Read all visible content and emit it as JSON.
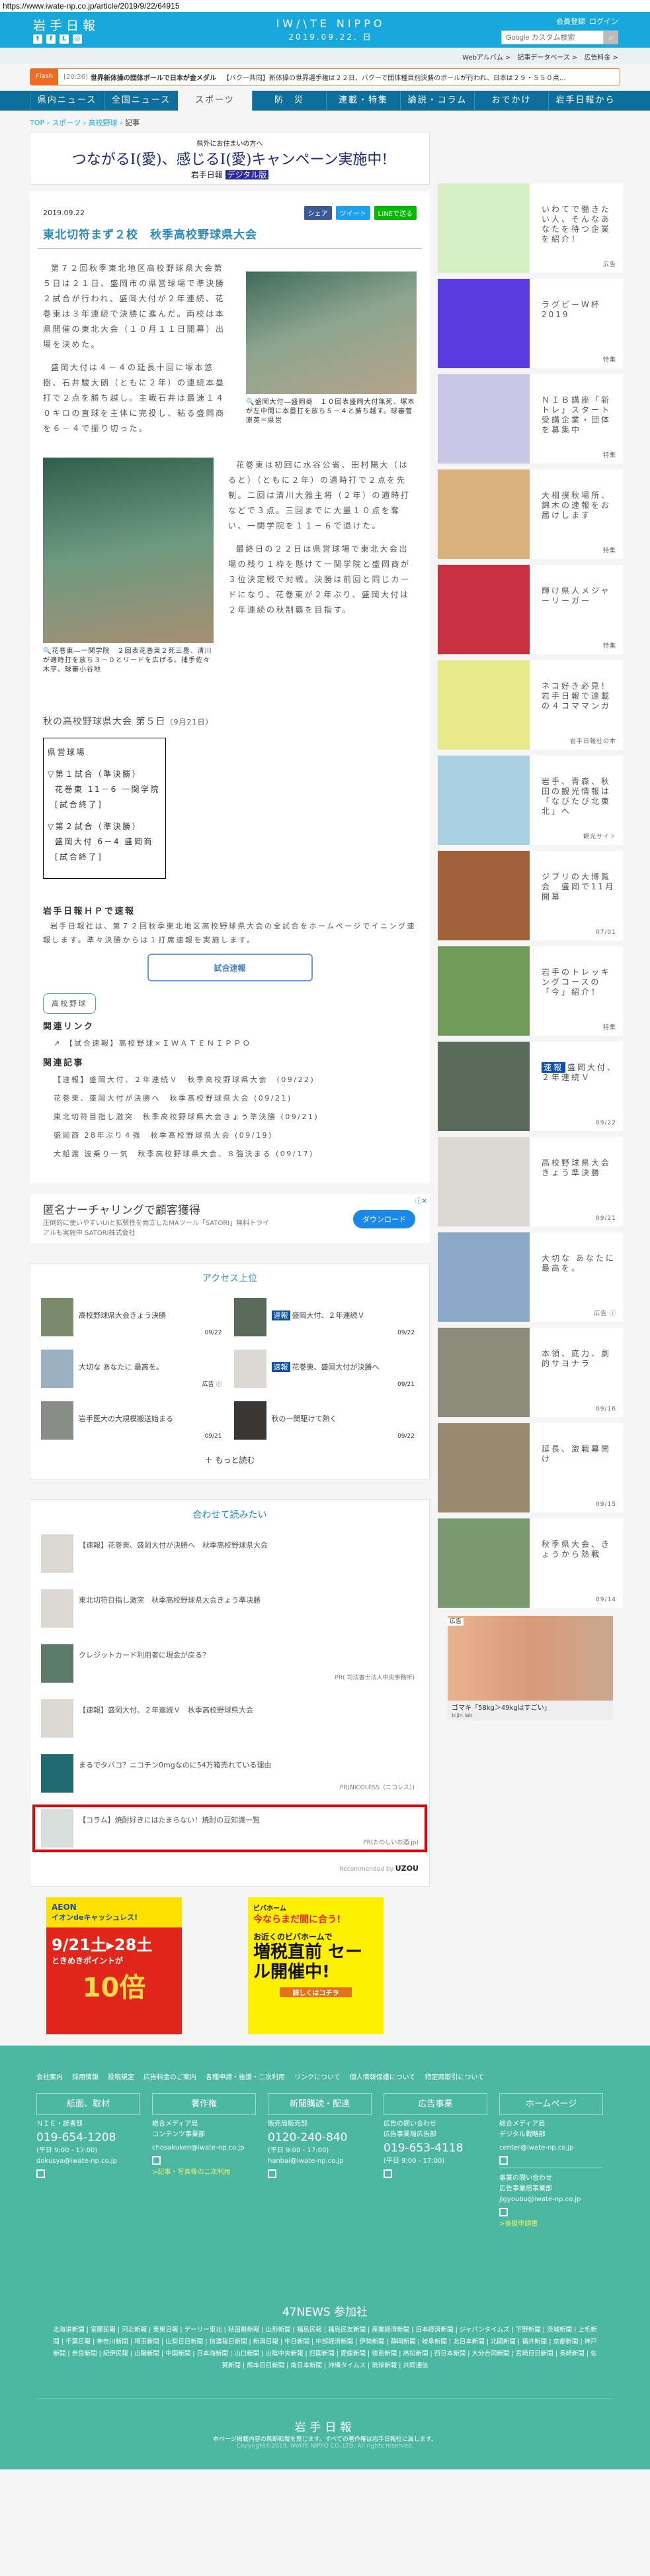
{
  "url": "https://www.iwate-np.co.jp/article/2019/9/22/64915",
  "header": {
    "logo": "岩手日報",
    "brand": "IW/\\TE NIPPO",
    "date": "2019.09.22. 日",
    "register": "会員登録",
    "login": "ログイン",
    "search_placeholder": "Google カスタム検索",
    "sublinks": [
      "Webアルバム >",
      "記事データベース >",
      "広告料金 >"
    ]
  },
  "flash": {
    "label": "Flash",
    "time": "[20:26]",
    "headline": "世界新体操の団体ボールで日本が金メダル",
    "text": "【バクー共同】新体操の世界選手権は２２日、バクーで団体種目別決勝のボールが行われ、日本は２９・５５０点…"
  },
  "nav": [
    "県内ニュース",
    "全国ニュース",
    "スポーツ",
    "防　災",
    "連載・特集",
    "論説・コラム",
    "おでかけ",
    "岩手日報から"
  ],
  "breadcrumb": {
    "top": "TOP",
    "sports": "スポーツ",
    "baseball": "高校野球",
    "current": "記事"
  },
  "banner": {
    "sub": "県外にお住まいの方へ",
    "main": "つながるI(愛)、感じるI(愛)キャンペーン実施中!",
    "logo": "岩手日報",
    "digital": "デジタル版"
  },
  "article": {
    "date": "2019.09.22",
    "share": {
      "fb": "シェア",
      "tw": "ツイート",
      "line": "LINEで送る"
    },
    "title": "東北切符まず２校　秋季高校野球県大会",
    "p1": "第７２回秋季東北地区高校野球県大会第５日は２１日、盛岡市の県営球場で準決勝２試合が行われ、盛岡大付が２年連続、花巻東は３年連続で決勝に進んだ。両校は本県開催の東北大会（１０月１１日開幕）出場を決めた。",
    "p2": "盛岡大付は４－４の延長十回に塚本悠樹、石井駿大朗（ともに２年）の連続本塁打で２点を勝ち越し。主戦石井は最速１４０キロの直球を主体に完投し、粘る盛岡商を６－４で振り切った。",
    "cap1": "盛岡大付―盛岡商　１０回表盛岡大付無死、塚本が左中間に本塁打を放ち５－４と勝ち越す。球審菅原英＝県営",
    "p3": "花巻東は初回に水谷公省、田村陽大（はると）（ともに２年）の適時打で２点を先制。二回は清川大雅主将（２年）の適時打などで３点。三回までに大量１０点を奪い、一関学院を１１－６で退けた。",
    "p4": "最終日の２２日は県営球場で東北大会出場の残り１枠を懸けて一関学院と盛岡商が３位決定戦で対戦。決勝は前回と同じカードになり、花巻東が２年ぶり、盛岡大付は２年連続の秋制覇を目指す。",
    "cap2": "花巻東―一関学院　２回表花巻東２死三塁、清川が適時打を放ち３－０とリードを広げる。捕手佐々木亨、球審小谷地",
    "results_title": "秋の高校野球県大会 第５日",
    "results_date": "（9月21日）",
    "results": {
      "venue": "県営球場",
      "g1": "▽第１試合（準決勝）",
      "g1s": "花巻東 11－6 一関学院",
      "g1st": "[試合終了]",
      "g2": "▽第２試合（準決勝）",
      "g2s": "盛岡大付 6－4 盛岡商",
      "g2st": "[試合終了]"
    },
    "hp_title": "岩手日報ＨＰで速報",
    "hp_text": "岩手日報社は、第７２回秋季東北地区高校野球県大会の全試合をホームページでイニング速報します。準々決勝からは１打席速報を実施します。",
    "live_button": "試合速報",
    "tag": "高校野球",
    "links_title": "関連リンク",
    "link1": "【試合速報】高校野球×ＩＷＡＴＥＮＩＰＰＯ",
    "related_title": "関連記事",
    "related": [
      "【速報】盛岡大付、２年連続Ｖ　秋季高校野球県大会　(09/22)",
      "花巻東、盛岡大付が決勝へ　秋季高校野球県大会 (09/21)",
      "東北切符目指し激突　秋季高校野球県大会きょう準決勝 (09/21)",
      "盛岡商 28年ぶり４強　秋季高校野球県大会 (09/19)",
      "大船渡 波乗り一気　秋季高校野球県大会、８強決まる (09/17)"
    ]
  },
  "ad_mid": {
    "title": "匿名ナーチャリングで顧客獲得",
    "text": "圧倒的に使いやすいUIと拡張性を両立したMAツール「SATORI」無料トライアルも実施中 SATORI株式会社",
    "button": "ダウンロード"
  },
  "access": {
    "title": "アクセス上位",
    "items": [
      {
        "title": "高校野球県大会きょう決勝",
        "badge": "",
        "date": "09/22",
        "thumb": "#7a8a6a"
      },
      {
        "title": "盛岡大付、２年連続Ｖ",
        "badge": "速報",
        "date": "09/22",
        "thumb": "#5a6b5a"
      },
      {
        "title": "大切な あなたに 最高を。",
        "badge": "",
        "date": "広告 ⓘ",
        "thumb": "#9cb0c4"
      },
      {
        "title": "花巻東、盛岡大付が決勝へ",
        "badge": "速報",
        "date": "09/21",
        "thumb": "#dcd9d2"
      },
      {
        "title": "岩手医大の大規模搬送始まる",
        "badge": "",
        "date": "09/21",
        "thumb": "#8a8d88"
      },
      {
        "title": "秋の一関駆けて熱く",
        "badge": "",
        "date": "09/22",
        "thumb": "#3a3634"
      }
    ],
    "more": "＋ もっと読む"
  },
  "readmore": {
    "title": "合わせて読みたい",
    "items": [
      {
        "title": "【速報】花巻東、盛岡大付が決勝へ　秋季高校野球県大会",
        "pr": "",
        "thumb": "#dcd9d2"
      },
      {
        "title": "東北切符目指し激突　秋季高校野球県大会きょう準決勝",
        "pr": "",
        "thumb": "#dcd9d2"
      },
      {
        "title": "クレジットカード利用者に現金が戻る？",
        "pr": "PR( 司法書士法人中央事務所)",
        "thumb": "#5b7a6a"
      },
      {
        "title": "【速報】盛岡大付、２年連続Ｖ　秋季高校野球県大会",
        "pr": "",
        "thumb": "#dcd9d2"
      },
      {
        "title": "まるでタバコ？ニコチン0mgなのに54万箱売れている理由",
        "pr": "PR(NICOLESS（ニコレス）)",
        "thumb": "#1f6a70"
      }
    ],
    "highlight": {
      "title": "【コラム】焼酎好きにはたまらない！焼酎の豆知識一覧",
      "pr": "PR(たのしいお酒.jp)",
      "thumb": "#d8dedc"
    },
    "recommended": "Recommended by",
    "uzou": "UZOU"
  },
  "ads_bottom": [
    {
      "brand": "AEON",
      "text": "イオンdeキャッシュレス!",
      "date": "9/21土▸28土",
      "sub": "ときめきポイントが",
      "big": "10倍"
    },
    {
      "brand": "ビバホーム",
      "text": "今ならまだ間に合う!",
      "date": "お近くのビバホームで",
      "sub": "増税直前 セール開催中!",
      "big": "詳しくはコチラ"
    }
  ],
  "sidebar": [
    {
      "text": "いわてで働きたい人、そんなあなたを待つ企業を紹介！",
      "label": "広告",
      "badge": "",
      "thumb": "#d8efc4"
    },
    {
      "text": "ラグビーW杯2019",
      "label": "特集",
      "badge": "",
      "thumb": "#5a3ce0"
    },
    {
      "text": "ＮＩＢ講座「新トレ」スタート　受講企業・団体を募集中",
      "label": "特集",
      "badge": "",
      "thumb": "#c9c6e6"
    },
    {
      "text": "大相撲秋場所、錦木の速報をお届けします",
      "label": "特集",
      "badge": "",
      "thumb": "#d8b27a"
    },
    {
      "text": "輝け県人メジャーリーガー",
      "label": "特集",
      "badge": "",
      "thumb": "#c83040"
    },
    {
      "text": "ネコ好き必見！岩手日報で連載の４コママンガ",
      "label": "岩手日報社の本",
      "badge": "",
      "thumb": "#e8ea8a"
    },
    {
      "text": "岩手、青森、秋田の観光情報は「なびたび北東北」へ",
      "label": "観光サイト",
      "badge": "",
      "thumb": "#a8d0e0"
    },
    {
      "text": "ジブリの大博覧会　盛岡で11月開幕",
      "label": "07/01",
      "badge": "",
      "thumb": "#a0603a"
    },
    {
      "text": "岩手のトレッキングコースの「今」紹介！",
      "label": "特集",
      "badge": "",
      "thumb": "#6f9a58"
    },
    {
      "text": "盛岡大付、２年連続Ｖ",
      "label": "09/22",
      "badge": "速報",
      "thumb": "#5a6b5a"
    },
    {
      "text": "高校野球県大会きょう準決勝",
      "label": "09/21",
      "badge": "",
      "thumb": "#dcd9d2"
    },
    {
      "text": "大切な あなたに 最高を。",
      "label": "広告 ⓘ",
      "badge": "",
      "thumb": "#8aa8c8"
    },
    {
      "text": "本領、底力、劇的サヨナラ",
      "label": "09/16",
      "badge": "",
      "thumb": "#8c8a7a"
    },
    {
      "text": "延長、激戦幕開け",
      "label": "09/15",
      "badge": "",
      "thumb": "#9a8a70"
    },
    {
      "text": "秋季県大会、きょうから熱戦",
      "label": "09/14",
      "badge": "",
      "thumb": "#7a9a70"
    }
  ],
  "side_ad": {
    "label": "広告",
    "caption": "ゴマキ「58kg＞49kgはすごい」",
    "source": "bijin.lab"
  },
  "footer": {
    "links": [
      "会社案内",
      "採用情報",
      "投稿規定",
      "広告料金のご案内",
      "各種申請・後援・二次利用",
      "リンクについて",
      "個人情報保護について",
      "特定商取引について"
    ],
    "cols": [
      {
        "head": "紙面、取材",
        "l1": "ＮＩＥ・読者部",
        "l2": "",
        "tel": "019-654-1208",
        "hours": "(平日 9:00 - 17:00)",
        "mail": "dokusya@iwate-np.co.jp",
        "link": ""
      },
      {
        "head": "著作権",
        "l1": "総合メディア局",
        "l2": "コンテンツ事業部",
        "tel": "",
        "hours": "",
        "mail": "chosakuken@iwate-np.co.jp",
        "link": ">記事・写真等の二次利用"
      },
      {
        "head": "新聞購読・配達",
        "l1": "販売局販売部",
        "l2": "",
        "tel": "0120-240-840",
        "hours": "(平日 9:00 - 17:00)",
        "mail": "hanbai@iwate-np.co.jp",
        "link": ""
      },
      {
        "head": "広告事業",
        "l1": "広告の問い合わせ",
        "l2": "広告事業局広告部",
        "tel": "019-653-4118",
        "hours": "(平日 9:00 - 17:00)",
        "mail": "",
        "link": ""
      },
      {
        "head": "ホームページ",
        "l1": "総合メディア局",
        "l2": "デジタル戦略部",
        "tel": "",
        "hours": "",
        "mail": "center@iwate-np.co.jp",
        "link": ""
      }
    ],
    "biz": {
      "l1": "事業の問い合わせ",
      "l2": "広告事業局事業部",
      "mail": "jigyoubu@iwate-np.co.jp",
      "link": ">後援申請書"
    },
    "news_title": "47NEWS 参加社",
    "papers": "北海道新聞 | 室蘭民報 | 河北新報 | 東奥日報 | デーリー東北 | 秋田魁新報 | 山形新聞 | 福島民報 | 福島民友新聞 | 産業経済新聞 | 日本経済新聞 | ジャパンタイムズ | 下野新聞 | 茨城新聞 | 上毛新聞 | 千葉日報 | 神奈川新聞 | 埼玉新聞 | 山梨日日新聞 | 信濃毎日新聞 | 新潟日報 | 中日新聞 | 中部経済新聞 | 伊勢新聞 | 静岡新聞 | 岐阜新聞 | 北日本新聞 | 北國新聞 | 福井新聞 | 京都新聞 | 神戸新聞 | 奈良新聞 | 紀伊民報 | 山陽新聞 | 中国新聞 | 日本海新聞 | 山口新聞 | 山陰中央新報 | 四国新聞 | 愛媛新聞 | 徳島新聞 | 高知新聞 | 西日本新聞 | 大分合同新聞 | 宮崎日日新聞 | 長崎新聞 | 佐賀新聞 | 熊本日日新聞 | 南日本新聞 | 沖縄タイムス | 琉球新報 | 共同通信",
    "logo": "岩手日報",
    "notice": "本ページ掲載内容の無断転載を禁じます。すべての著作権は岩手日報社に属します。",
    "copyright": "Copyright©2019, IWATE NIPPO CO.,LTD. All rights reserved."
  },
  "colors": {
    "header": "#19a8dd",
    "nav": "#0e6f9c",
    "flash": "#f26a21",
    "footer": "#4db8a2",
    "highlight": "#ee0000"
  }
}
